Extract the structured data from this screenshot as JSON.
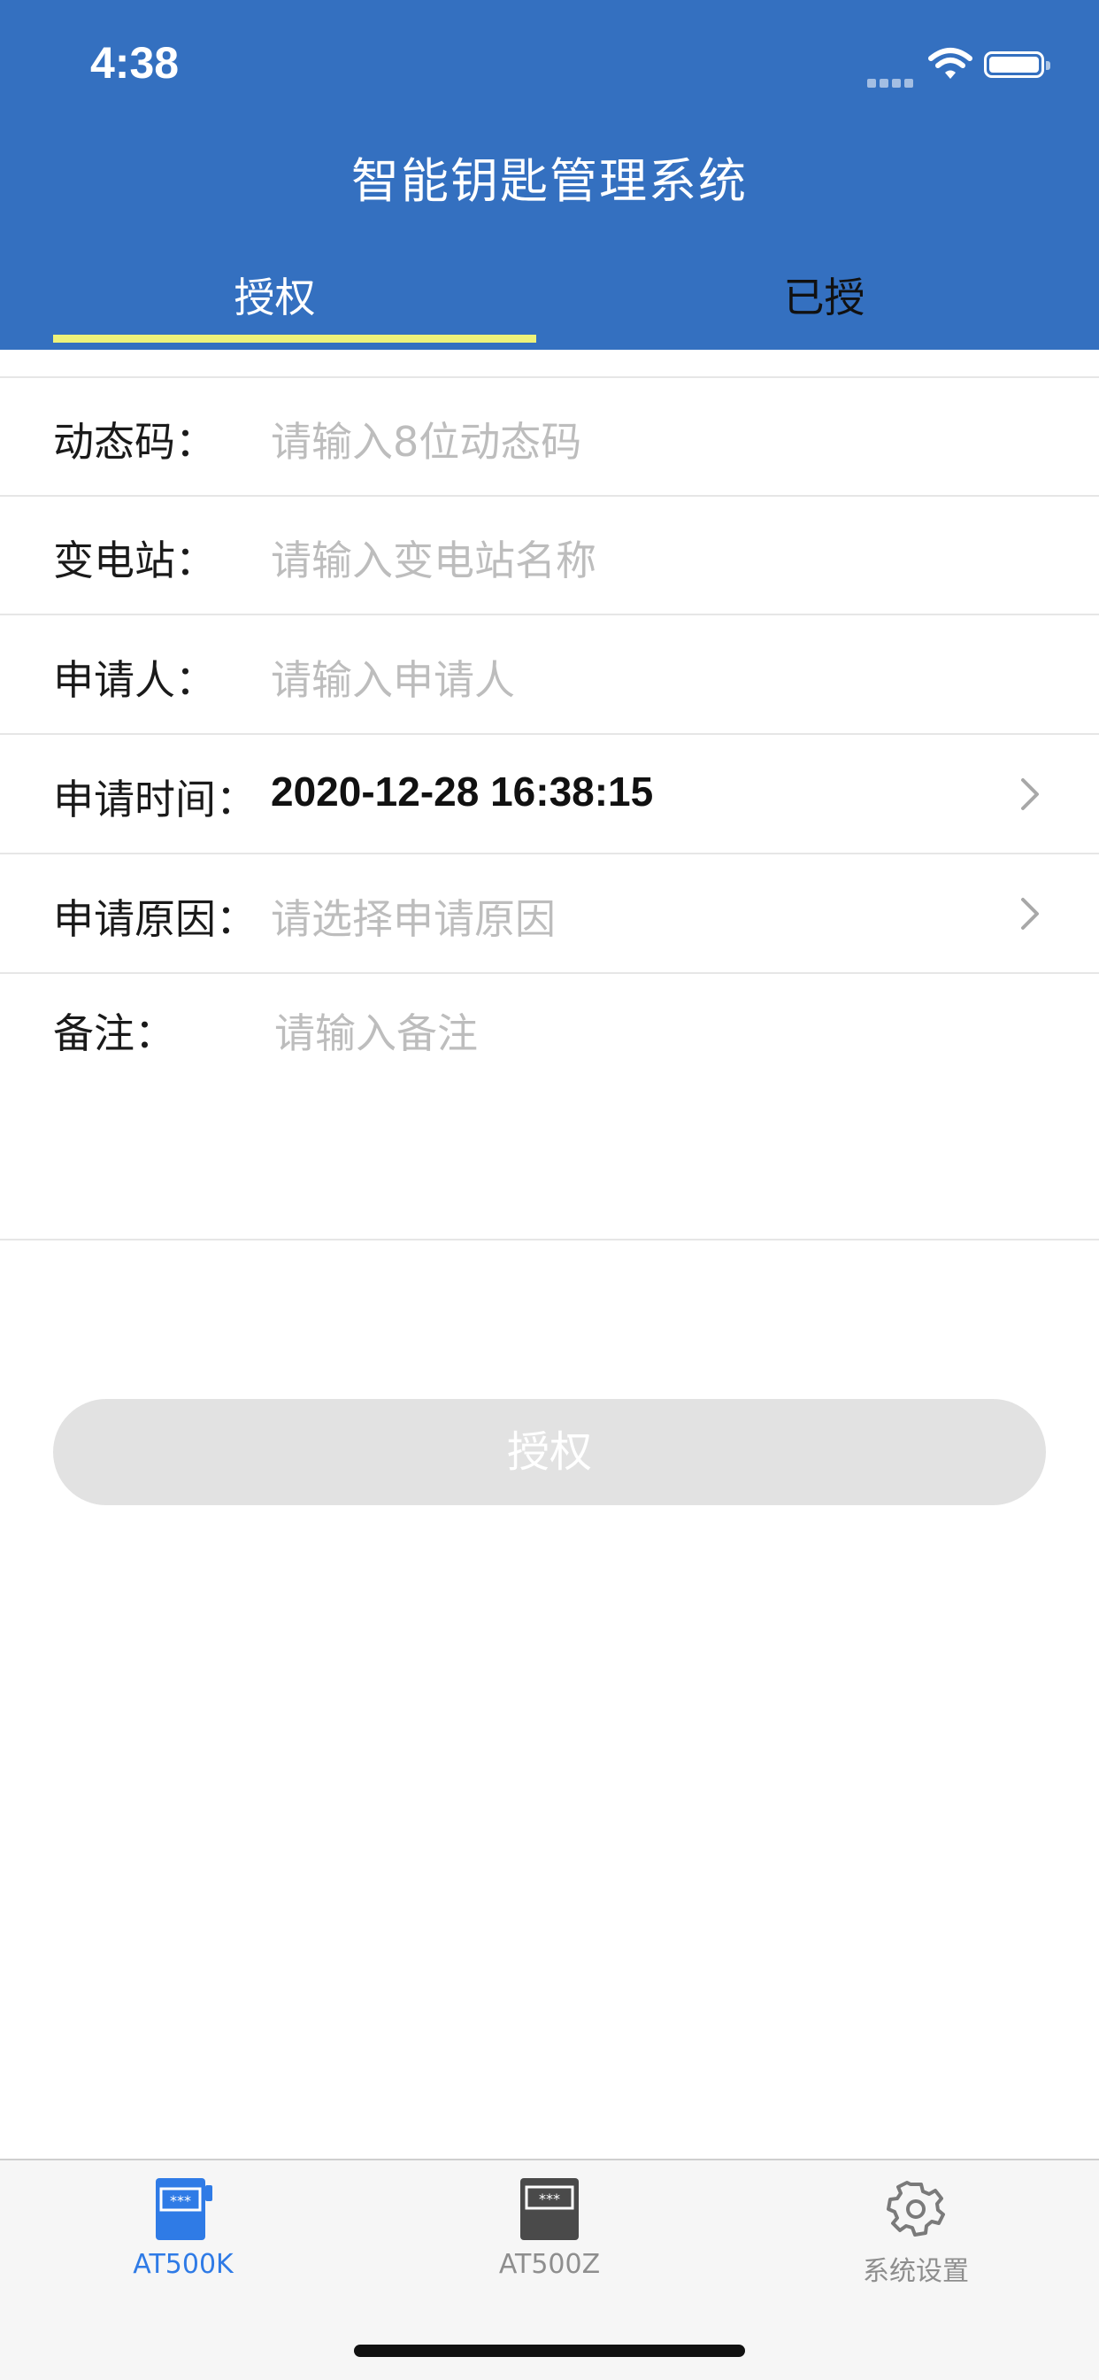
{
  "status_bar": {
    "time": "4:38"
  },
  "header": {
    "title": "智能钥匙管理系统"
  },
  "tabs": [
    {
      "label": "授权",
      "active": true
    },
    {
      "label": "已授",
      "active": false
    }
  ],
  "form": {
    "dynamic_code": {
      "label": "动态码：",
      "placeholder": "请输入8位动态码"
    },
    "substation": {
      "label": "变电站：",
      "placeholder": "请输入变电站名称"
    },
    "applicant": {
      "label": "申请人：",
      "placeholder": "请输入申请人"
    },
    "apply_time": {
      "label": "申请时间：",
      "value": "2020-12-28 16:38:15"
    },
    "apply_reason": {
      "label": "申请原因：",
      "placeholder": "请选择申请原因"
    },
    "remarks": {
      "label": "备注：",
      "placeholder": "请输入备注"
    }
  },
  "submit_button": {
    "label": "授权"
  },
  "tabbar": [
    {
      "label": "AT500K",
      "icon": "at500k-device-icon",
      "active": true
    },
    {
      "label": "AT500Z",
      "icon": "at500z-device-icon",
      "active": false
    },
    {
      "label": "系统设置",
      "icon": "gear-icon",
      "active": false
    }
  ],
  "colors": {
    "header_bg": "#3470c0",
    "tab_indicator": "#eef27a",
    "tabbar_active": "#2f7be6",
    "button_disabled": "#e2e2e2"
  }
}
